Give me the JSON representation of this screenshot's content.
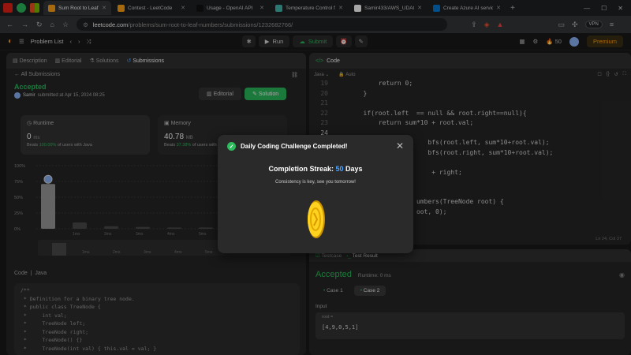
{
  "browser": {
    "tabs": [
      {
        "title": "Sum Root to Leaf Num",
        "active": true,
        "fav_color": "#ffa116"
      },
      {
        "title": "Contest - LeetCode",
        "active": false,
        "fav_color": "#ffa116"
      },
      {
        "title": "Usage - OpenAI API",
        "active": false,
        "fav_color": "#111111"
      },
      {
        "title": "Temperature Control for M",
        "active": false,
        "fav_color": "#3fb8af"
      },
      {
        "title": "Samir433/AWS_UDACITY_",
        "active": false,
        "fav_color": "#ffffff"
      },
      {
        "title": "Create Azure AI services -",
        "active": false,
        "fav_color": "#0078d4"
      }
    ],
    "url_host": "leetcode.com",
    "url_path": "/problems/sum-root-to-leaf-numbers/submissions/1232682766/",
    "vpn_label": "VPN"
  },
  "toolbar": {
    "problem_list": "Problem List",
    "run": "Run",
    "submit": "Submit",
    "coins": "50",
    "premium": "Premium"
  },
  "left_panel": {
    "tabs": [
      "Description",
      "Editorial",
      "Solutions",
      "Submissions"
    ],
    "all_submissions": "All Submissions",
    "status": "Accepted",
    "user": "Samir",
    "submitted_text": "submitted at Apr 15, 2024 08:25",
    "editorial_btn": "Editorial",
    "solution_btn": "Solution",
    "runtime": {
      "label": "Runtime",
      "value": "0",
      "unit": "ms",
      "beats_pre": "Beats",
      "beats_pct": "100.00%",
      "beats_post": "of users with Java"
    },
    "memory": {
      "label": "Memory",
      "value": "40.78",
      "unit": "MB",
      "beats_pre": "Beats",
      "beats_pct": "37.38%",
      "beats_post": "of users with Java"
    },
    "code_header": [
      "Code",
      "Java"
    ],
    "code_lines": [
      "/**",
      " * Definition for a binary tree node.",
      " * public class TreeNode {",
      " *     int val;",
      " *     TreeNode left;",
      " *     TreeNode right;",
      " *     TreeNode() {}",
      " *     TreeNode(int val) { this.val = val; }"
    ]
  },
  "chart_data": {
    "type": "bar",
    "y_ticks": [
      "100%",
      "75%",
      "50%",
      "25%",
      "0%"
    ],
    "categories": [
      "0ms",
      "1ms",
      "2ms",
      "3ms",
      "4ms",
      "5ms",
      "6ms",
      "7ms"
    ],
    "values": [
      71,
      10,
      4,
      3,
      2,
      2,
      2,
      1
    ],
    "ylim": [
      0,
      100
    ],
    "highlight_index": 0,
    "brush_ticks": [
      "1ms",
      "2ms",
      "3ms",
      "4ms",
      "5ms",
      "6ms",
      "7ms"
    ]
  },
  "editor": {
    "title": "Code",
    "language": "Java",
    "mode": "Auto",
    "cursor_pos": "Ln 24, Col 37",
    "lines": [
      {
        "n": "19",
        "code": "            return 0;"
      },
      {
        "n": "20",
        "code": "        }"
      },
      {
        "n": "21",
        "code": ""
      },
      {
        "n": "22",
        "code": "        if(root.left  == null && root.right==null){"
      },
      {
        "n": "23",
        "code": "            return sum*10 + root.val;"
      },
      {
        "n": "24",
        "code": ""
      },
      {
        "n": "25",
        "code": "                         bfs(root.left, sum*10+root.val);"
      },
      {
        "n": "26",
        "code": "                         bfs(root.right, sum*10+root.val);"
      },
      {
        "n": "27",
        "code": ""
      },
      {
        "n": "28",
        "code": "                          + right;"
      },
      {
        "n": "29",
        "code": ""
      },
      {
        "n": "30",
        "code": ""
      },
      {
        "n": "31",
        "code": "                      umbers(TreeNode root) {"
      },
      {
        "n": "32",
        "code": "                      oot, 0);"
      }
    ]
  },
  "test_result": {
    "tabs": [
      "Testcase",
      "Test Result"
    ],
    "status": "Accepted",
    "runtime": "Runtime: 0 ms",
    "cases": [
      "Case 1",
      "Case 2"
    ],
    "selected_case": 1,
    "input_label": "Input",
    "var_name": "root =",
    "var_value": "[4,9,0,5,1]"
  },
  "modal": {
    "title": "Daily Coding Challenge Completed!",
    "streak_pre": "Completion Streak:",
    "streak_num": "50",
    "streak_post": "Days",
    "subtitle": "Consistency is key, see you tomorrow!"
  },
  "colors": {
    "accent": "#ffa116",
    "green": "#2cbb5d",
    "blue": "#4aa3ff"
  }
}
